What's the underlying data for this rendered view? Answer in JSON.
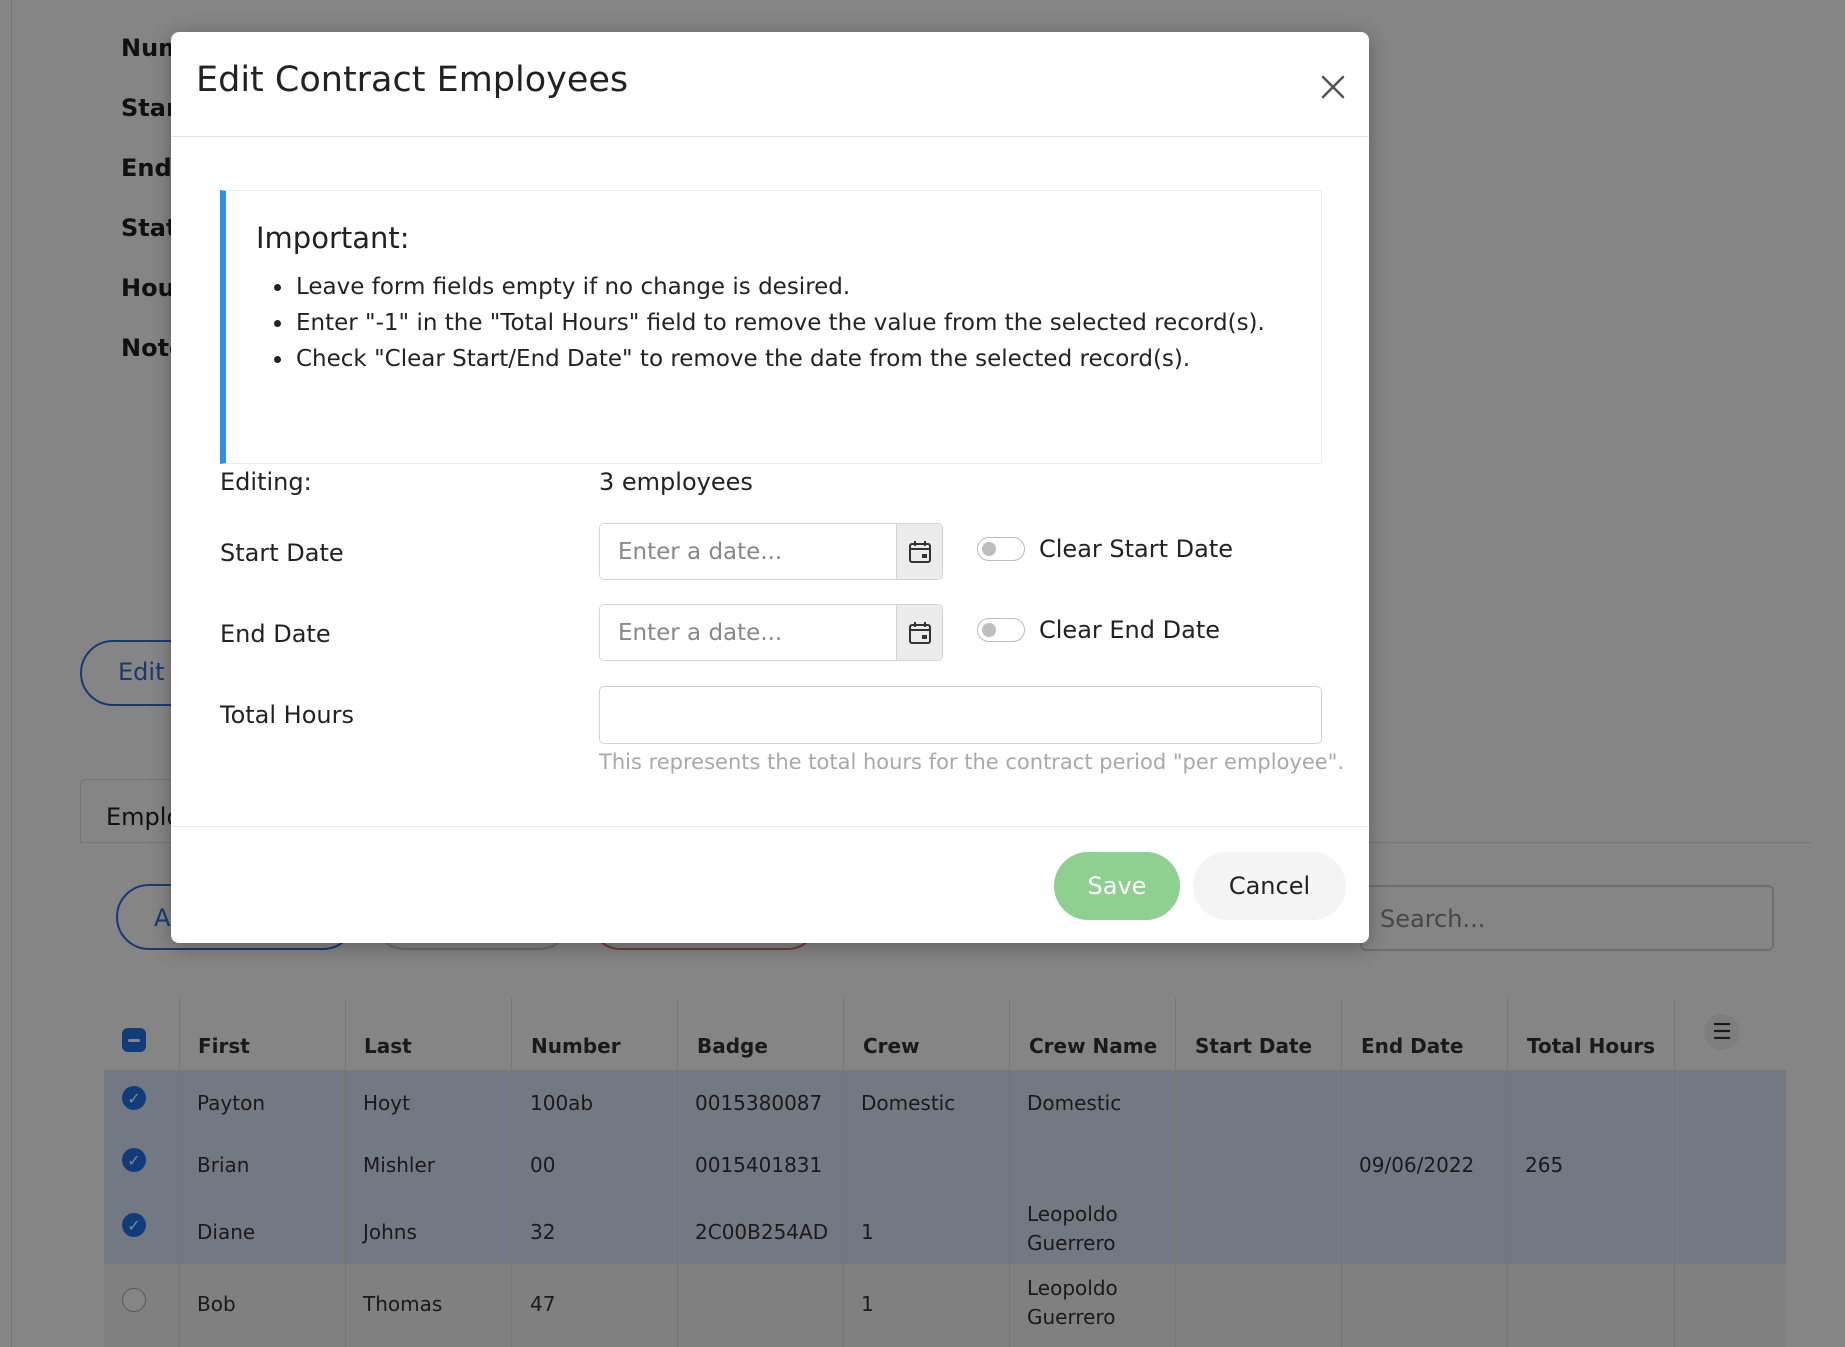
{
  "background": {
    "detail_labels": [
      "Num",
      "Start",
      "End",
      "Statu",
      "Hour",
      "Note"
    ],
    "edit_button_label": "Edit",
    "employees_tab_label": "Emplo",
    "add_button_label": "A",
    "search_placeholder": "Search...",
    "table": {
      "headers": [
        "First",
        "Last",
        "Number",
        "Badge",
        "Crew",
        "Crew Name",
        "Start Date",
        "End Date",
        "Total Hours"
      ],
      "rows": [
        {
          "first": "Payton",
          "last": "Hoyt",
          "number": "100ab",
          "badge": "0015380087",
          "crew": "Domestic",
          "crew_name": "Domestic",
          "crew_name_2": "",
          "start": "",
          "end": "",
          "hours": "",
          "selected": true
        },
        {
          "first": "Brian",
          "last": "Mishler",
          "number": "00",
          "badge": "0015401831",
          "crew": "",
          "crew_name": "",
          "crew_name_2": "",
          "start": "",
          "end": "09/06/2022",
          "hours": "265",
          "selected": true
        },
        {
          "first": "Diane",
          "last": "Johns",
          "number": "32",
          "badge": "2C00B254AD",
          "crew": "1",
          "crew_name": "Leopoldo",
          "crew_name_2": "Guerrero",
          "start": "",
          "end": "",
          "hours": "",
          "selected": true
        },
        {
          "first": "Bob",
          "last": "Thomas",
          "number": "47",
          "badge": "",
          "crew": "1",
          "crew_name": "Leopoldo",
          "crew_name_2": "Guerrero",
          "start": "",
          "end": "",
          "hours": "",
          "selected": false
        }
      ]
    }
  },
  "modal": {
    "title": "Edit Contract Employees",
    "callout": {
      "title": "Important:",
      "items": [
        "Leave form fields empty if no change is desired.",
        "Enter \"-1\" in the \"Total Hours\" field to remove the value from the selected record(s).",
        "Check \"Clear Start/End Date\" to remove the date from the selected record(s)."
      ]
    },
    "form": {
      "editing_label": "Editing:",
      "editing_value": "3 employees",
      "start_date_label": "Start Date",
      "start_date_placeholder": "Enter a date...",
      "clear_start_label": "Clear Start Date",
      "end_date_label": "End Date",
      "end_date_placeholder": "Enter a date...",
      "clear_end_label": "Clear End Date",
      "total_hours_label": "Total Hours",
      "total_hours_value": "",
      "total_hours_help": "This represents the total hours for the contract period \"per employee\"."
    },
    "footer": {
      "save_label": "Save",
      "cancel_label": "Cancel"
    }
  },
  "colors": {
    "accent": "#2e6fd8",
    "callout_border": "#2f8fe8",
    "save_button": "#8fcf8f"
  }
}
